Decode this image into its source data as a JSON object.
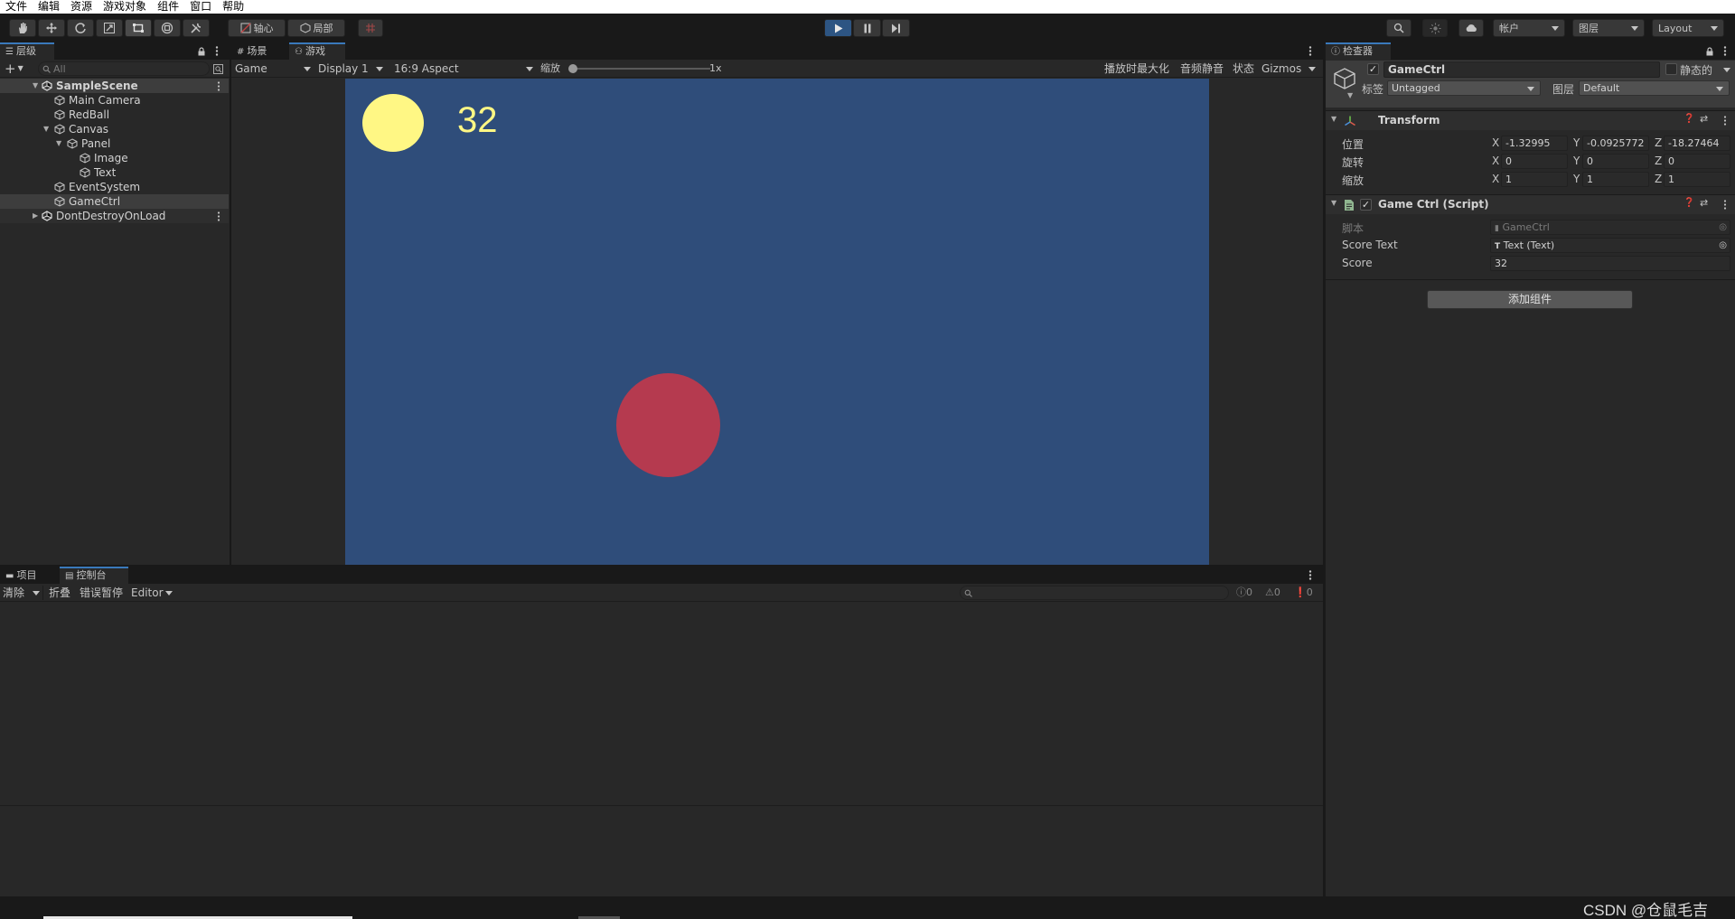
{
  "menu": [
    "文件",
    "编辑",
    "资源",
    "游戏对象",
    "组件",
    "窗口",
    "帮助"
  ],
  "toolbar": {
    "pivot_label": "轴心",
    "local_label": "局部",
    "account_label": "帐户",
    "layers_label": "图层",
    "layout_label": "Layout"
  },
  "hierarchy": {
    "tab_label": "层级",
    "search_placeholder": "All",
    "items": [
      {
        "label": "SampleScene"
      },
      {
        "label": "Main Camera"
      },
      {
        "label": "RedBall"
      },
      {
        "label": "Canvas"
      },
      {
        "label": "Panel"
      },
      {
        "label": "Image"
      },
      {
        "label": "Text"
      },
      {
        "label": "EventSystem"
      },
      {
        "label": "GameCtrl"
      },
      {
        "label": "DontDestroyOnLoad"
      }
    ]
  },
  "game_view": {
    "tab_scene": "场景",
    "tab_game": "游戏",
    "mode_select": "Game",
    "display_select": "Display 1",
    "aspect_select": "16:9 Aspect",
    "scale_label": "缩放",
    "scale_value": "1x",
    "maximize_label": "播放时最大化",
    "mute_label": "音频静音",
    "stats_label": "状态",
    "gizmos_label": "Gizmos",
    "score_text": "32",
    "colors": {
      "background": "#2f4d7a",
      "yellow_ball": "#fff784",
      "red_ball": "#b53a4f",
      "score": "#fff784"
    }
  },
  "inspector": {
    "tab_label": "检查器",
    "object_name": "GameCtrl",
    "static_label": "静态的",
    "tag_label": "标签",
    "tag_value": "Untagged",
    "layer_label": "图层",
    "layer_value": "Default",
    "transform": {
      "title": "Transform",
      "position_label": "位置",
      "rotation_label": "旋转",
      "scale_label": "缩放",
      "position": {
        "x": "-1.32995",
        "y": "-0.0925772",
        "z": "-18.27464"
      },
      "rotation": {
        "x": "0",
        "y": "0",
        "z": "0"
      },
      "scale": {
        "x": "1",
        "y": "1",
        "z": "1"
      },
      "axis_x": "X",
      "axis_y": "Y",
      "axis_z": "Z"
    },
    "script_component": {
      "title": "Game Ctrl (Script)",
      "script_label": "脚本",
      "script_value": "GameCtrl",
      "score_text_label": "Score Text",
      "score_text_value": "Text (Text)",
      "score_label": "Score",
      "score_value": "32"
    },
    "add_component_label": "添加组件"
  },
  "bottom": {
    "tab_project": "项目",
    "tab_console": "控制台",
    "clear_label": "清除",
    "collapse_label": "折叠",
    "error_pause_label": "错误暂停",
    "editor_label": "Editor",
    "log_count": "0",
    "warning_count": "0",
    "error_count": "0"
  },
  "watermark": "CSDN @仓鼠毛吉"
}
